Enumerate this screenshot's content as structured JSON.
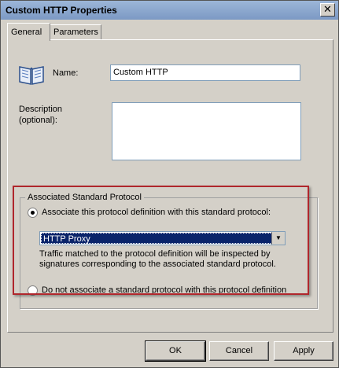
{
  "window": {
    "title": "Custom HTTP Properties",
    "close_glyph": "✕"
  },
  "tabs": [
    {
      "label": "General"
    },
    {
      "label": "Parameters"
    }
  ],
  "form": {
    "name_label": "Name:",
    "name_value": "Custom HTTP",
    "description_label_line1": "Description",
    "description_label_line2": "(optional):",
    "description_value": ""
  },
  "protocol_group": {
    "title": "Associated Standard Protocol",
    "associate_option": "Associate this protocol definition with this standard protocol:",
    "associate_selected": true,
    "selected_protocol": "HTTP Proxy",
    "note": "Traffic matched to the protocol definition will be inspected by signatures corresponding to the associated standard protocol.",
    "not_associate_option": "Do not associate a standard protocol with this protocol definition",
    "not_associate_selected": false
  },
  "buttons": {
    "ok": "OK",
    "cancel": "Cancel",
    "apply": "Apply"
  },
  "icons": {
    "protocol": "open-book-icon",
    "dropdown": "chevron-down-icon"
  },
  "colors": {
    "highlight_frame": "#b0262c",
    "selection": "#0a246a"
  }
}
